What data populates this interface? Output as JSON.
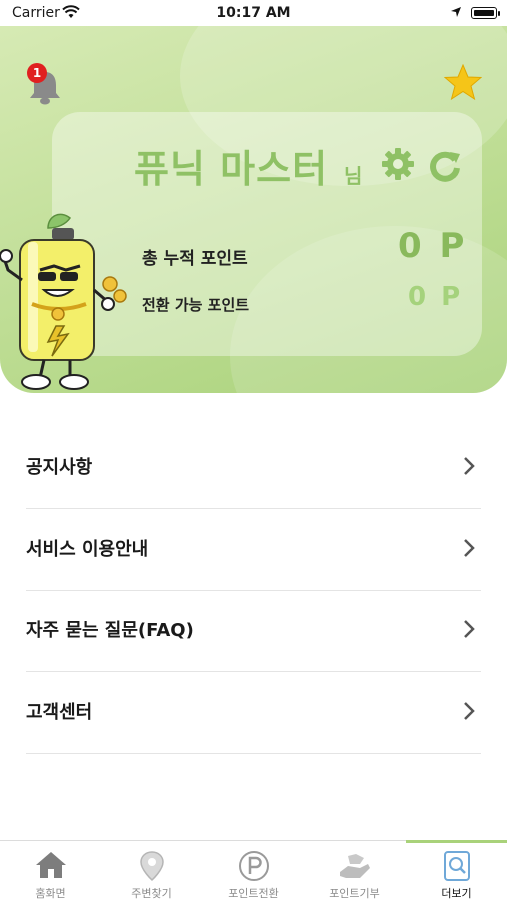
{
  "status_bar": {
    "carrier": "Carrier",
    "time": "10:17 AM"
  },
  "header": {
    "notification_count": "1",
    "user_name": "퓨닉 마스터",
    "honorific": "님",
    "total_points_label": "총 누적 포인트",
    "total_points_value": "0 P",
    "convertible_points_label": "전환 가능 포인트",
    "convertible_points_value": "0 P"
  },
  "menu": [
    {
      "label": "공지사항"
    },
    {
      "label": "서비스 이용안내"
    },
    {
      "label": "자주 묻는 질문(FAQ)"
    },
    {
      "label": "고객센터"
    }
  ],
  "tab_bar": {
    "active_index": 4,
    "tabs": [
      {
        "label": "홈화면",
        "icon": "home-icon"
      },
      {
        "label": "주변찾기",
        "icon": "location-pin-icon"
      },
      {
        "label": "포인트전환",
        "icon": "points-circle-icon"
      },
      {
        "label": "포인트기부",
        "icon": "donate-hand-icon"
      },
      {
        "label": "더보기",
        "icon": "more-search-icon"
      }
    ]
  },
  "colors": {
    "accent": "#a9d27a",
    "accent_dark": "#8fc165",
    "badge": "#e02020",
    "star": "#f5c518"
  }
}
